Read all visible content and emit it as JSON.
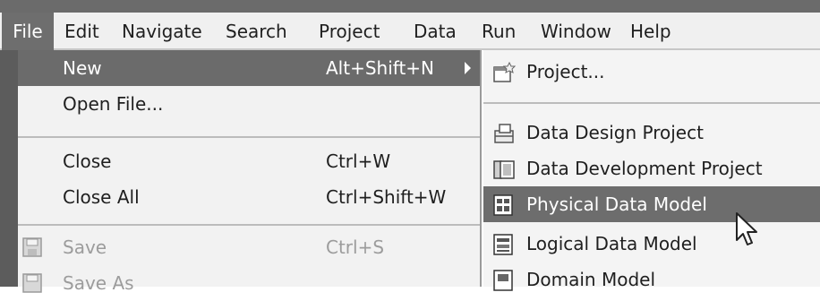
{
  "menubar": {
    "items": [
      {
        "label": "File"
      },
      {
        "label": "Edit"
      },
      {
        "label": "Navigate"
      },
      {
        "label": "Search"
      },
      {
        "label": "Project"
      },
      {
        "label": "Data"
      },
      {
        "label": "Run"
      },
      {
        "label": "Window"
      },
      {
        "label": "Help"
      }
    ]
  },
  "file_menu": {
    "items": [
      {
        "label": "New",
        "shortcut": "Alt+Shift+N"
      },
      {
        "label": "Open File..."
      },
      {
        "label": "Close",
        "shortcut": "Ctrl+W"
      },
      {
        "label": "Close All",
        "shortcut": "Ctrl+Shift+W"
      },
      {
        "label": "Save",
        "shortcut": "Ctrl+S",
        "icon": "save-icon"
      },
      {
        "label": "Save As",
        "icon": "save-as-icon"
      }
    ]
  },
  "new_submenu": {
    "items": [
      {
        "label": "Project...",
        "icon": "new-project-icon"
      },
      {
        "label": "Data Design Project",
        "icon": "data-design-project-icon"
      },
      {
        "label": "Data Development Project",
        "icon": "data-development-project-icon"
      },
      {
        "label": "Physical Data Model",
        "icon": "physical-data-model-icon"
      },
      {
        "label": "Logical Data Model",
        "icon": "logical-data-model-icon"
      },
      {
        "label": "Domain Model",
        "icon": "domain-model-icon"
      }
    ]
  },
  "colors": {
    "highlight": "#6b6b6b",
    "menu_bg": "#f2f2f2",
    "menubar_bg": "#f0f0f0",
    "disabled_text": "#9c9c9c"
  }
}
